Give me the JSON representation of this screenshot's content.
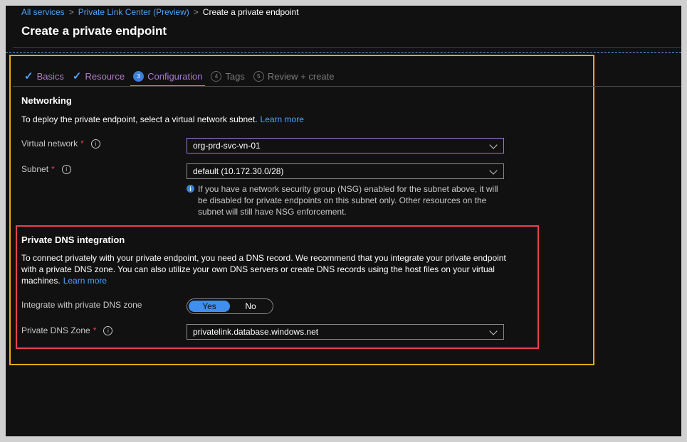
{
  "breadcrumb": [
    "All services",
    "Private Link Center (Preview)",
    "Create a private endpoint"
  ],
  "page_title": "Create a private endpoint",
  "tabs": [
    {
      "label": "Basics",
      "state": "completed"
    },
    {
      "label": "Resource",
      "state": "completed"
    },
    {
      "label": "Configuration",
      "state": "active",
      "num": "3"
    },
    {
      "label": "Tags",
      "state": "disabled",
      "num": "4"
    },
    {
      "label": "Review + create",
      "state": "disabled",
      "num": "5"
    }
  ],
  "networking": {
    "title": "Networking",
    "description": "To deploy the private endpoint, select a virtual network subnet.",
    "learn_more": "Learn more",
    "virtual_network_label": "Virtual network",
    "virtual_network_value": "org-prd-svc-vn-01",
    "subnet_label": "Subnet",
    "subnet_value": "default (10.172.30.0/28)",
    "nsg_note": "If you have a network security group (NSG) enabled for the subnet above, it will be disabled for private endpoints on this subnet only. Other resources on the subnet will still have NSG enforcement."
  },
  "dns": {
    "title": "Private DNS integration",
    "description": "To connect privately with your private endpoint, you need a DNS record. We recommend that you integrate your private endpoint with a private DNS zone. You can also utilize your own DNS servers or create DNS records using the host files on your virtual machines.",
    "learn_more": "Learn more",
    "integrate_label": "Integrate with private DNS zone",
    "toggle_yes": "Yes",
    "toggle_no": "No",
    "toggle_selected": "Yes",
    "zone_label": "Private DNS Zone",
    "zone_value": "privatelink.database.windows.net"
  },
  "required_marker": "*",
  "colors": {
    "highlight_outer": "#f3a81b",
    "highlight_inner": "#e8414b",
    "accent": "#3f8ef0"
  }
}
